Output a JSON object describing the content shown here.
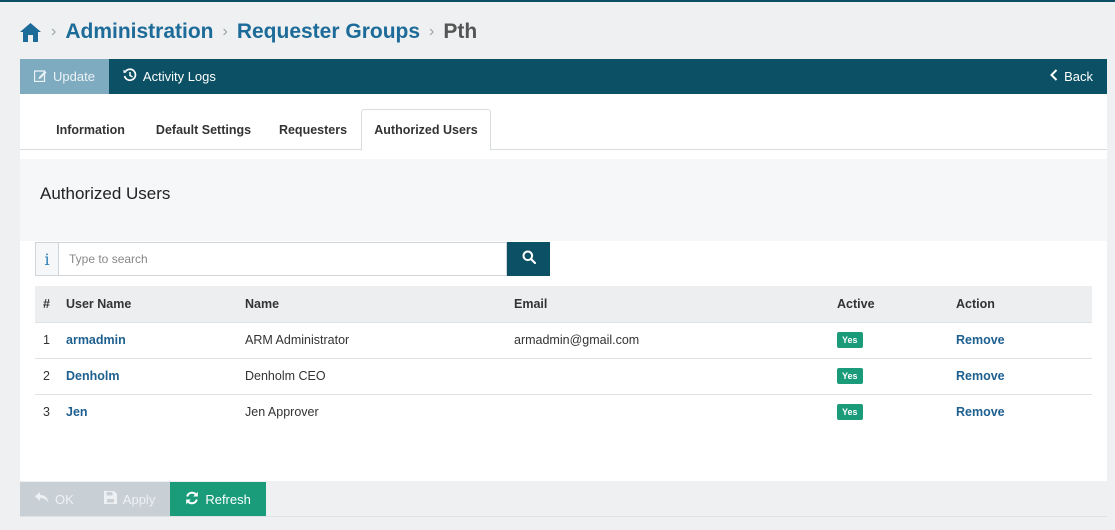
{
  "breadcrumb": {
    "items": [
      "Administration",
      "Requester Groups"
    ],
    "current": "Pth"
  },
  "toolbar": {
    "update_label": "Update",
    "activity_label": "Activity Logs",
    "back_label": "Back"
  },
  "tabs": [
    "Information",
    "Default Settings",
    "Requesters",
    "Authorized Users"
  ],
  "section": {
    "title": "Authorized Users"
  },
  "search": {
    "placeholder": "Type to search",
    "info_glyph": "i"
  },
  "table": {
    "headers": [
      "#",
      "User Name",
      "Name",
      "Email",
      "Active",
      "Action"
    ],
    "rows": [
      {
        "num": "1",
        "username": "armadmin",
        "name": "ARM Administrator",
        "email": "armadmin@gmail.com",
        "active": "Yes",
        "action": "Remove"
      },
      {
        "num": "2",
        "username": "Denholm",
        "name": "Denholm CEO",
        "email": "",
        "active": "Yes",
        "action": "Remove"
      },
      {
        "num": "3",
        "username": "Jen",
        "name": "Jen Approver",
        "email": "",
        "active": "Yes",
        "action": "Remove"
      }
    ]
  },
  "footer": {
    "ok_label": "OK",
    "apply_label": "Apply",
    "refresh_label": "Refresh"
  },
  "colors": {
    "primary": "#0b5064",
    "accent": "#1a9c7b",
    "link": "#1d5f8f"
  }
}
